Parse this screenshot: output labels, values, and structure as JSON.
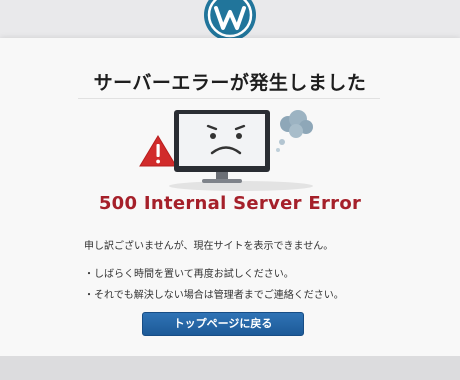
{
  "header": {
    "logo_icon": "wordpress-logo-icon",
    "logo_color": "#21759b"
  },
  "error_page": {
    "title": "サーバーエラーが発生しました",
    "illustration": {
      "monitor_icon": "sad-monitor-icon",
      "warning_icon": "warning-triangle-icon",
      "smoke_icon": "smoke-cloud-icon"
    },
    "error_code": "500 Internal Server Error",
    "messages": [
      "申し訳ございませんが、現在サイトを表示できません。",
      "・しばらく時間を置いて再度お試しください。",
      "・それでも解決しない場合は管理者までご連絡ください。"
    ],
    "home_button_label": "トップページに戻る"
  },
  "colors": {
    "accent_red": "#a5202a",
    "button_blue": "#2466a7",
    "warning_red": "#d12b2b"
  }
}
